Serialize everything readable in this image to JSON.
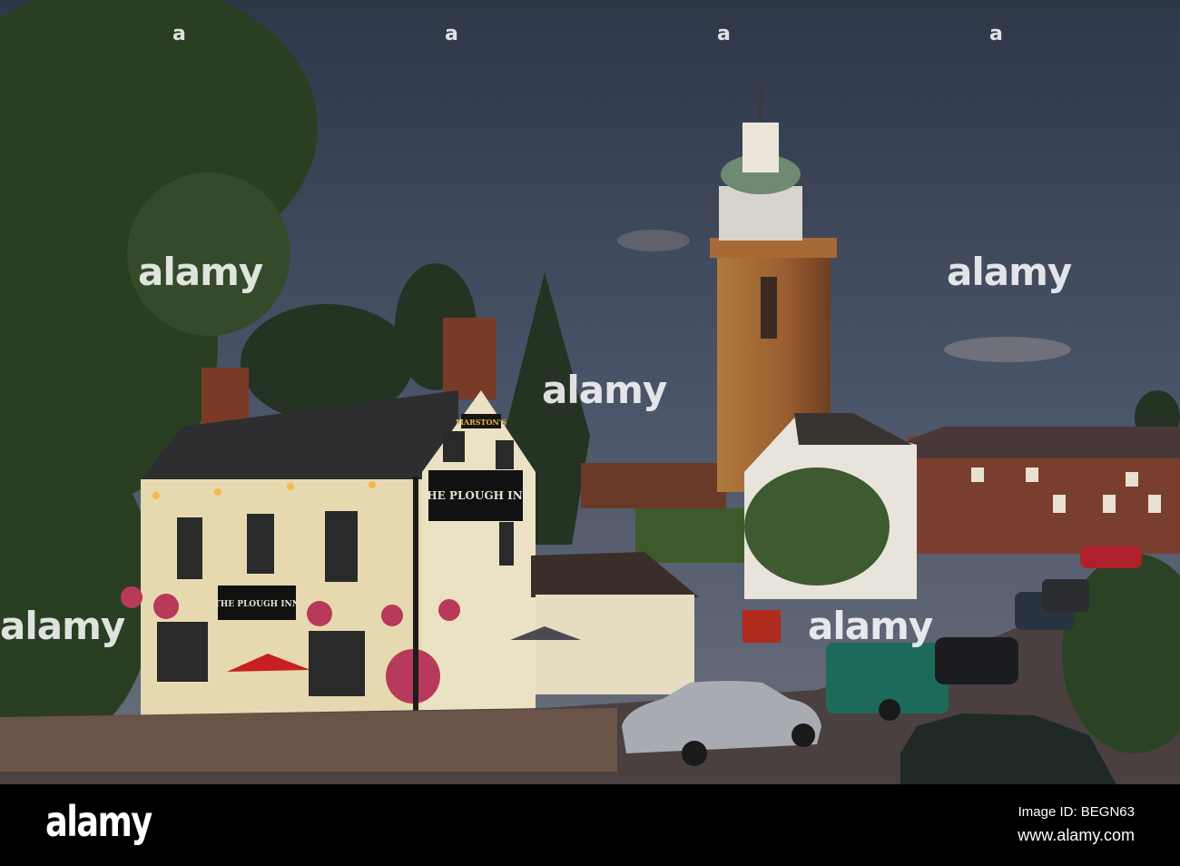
{
  "photo": {
    "pub_gable_sign": "THE PLOUGH INN",
    "pub_front_sign": "THE PLOUGH INN",
    "brewery_sign": "MARSTON'S"
  },
  "watermark": {
    "logo_text": "alamy",
    "small_mark": "a"
  },
  "footer": {
    "logo": "alamy",
    "image_id": "Image ID: BEGN63",
    "url": "www.alamy.com"
  }
}
